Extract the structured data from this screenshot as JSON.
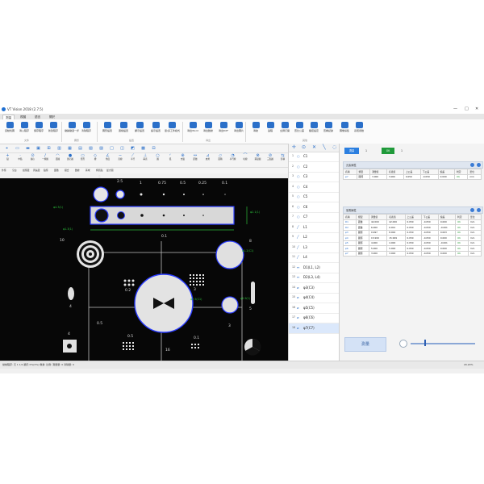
{
  "window": {
    "title": "VT Vision 2018 (2.7.5)",
    "controls": [
      "—",
      "□",
      "✕"
    ]
  },
  "menu_tabs": [
    "測量",
    "視圖",
    "語言",
    "關於"
  ],
  "ribbon": {
    "buttons": [
      {
        "label": "自動找圖",
        "color": "#2a6fc9"
      },
      {
        "label": "導入程序",
        "color": "#2a6fc9"
      },
      {
        "label": "保存程序",
        "color": "#2a6fc9"
      },
      {
        "label": "新建程序",
        "color": "#2a6fc9"
      },
      {
        "label": "撤銷撤退一步",
        "color": "#2a6fc9"
      },
      {
        "label": "清除程序",
        "color": "#2a6fc9"
      },
      {
        "label": "圖形設置",
        "color": "#2a6fc9"
      },
      {
        "label": "邊緣設置",
        "color": "#2a6fc9"
      },
      {
        "label": "顯示設置",
        "color": "#2a6fc9"
      },
      {
        "label": "提示設置",
        "color": "#2a6fc9"
      },
      {
        "label": "單/多工件模式",
        "color": "#2a6fc9"
      },
      {
        "label": "導出Word",
        "color": "#2a6fc9"
      },
      {
        "label": "導出數據",
        "color": "#2a6fc9"
      },
      {
        "label": "導出DXF",
        "color": "#2a6fc9"
      },
      {
        "label": "導出圖片",
        "color": "#2a6fc9"
      },
      {
        "label": "導航",
        "color": "#2a6fc9"
      },
      {
        "label": "遠程",
        "color": "#2a6fc9"
      },
      {
        "label": "全屏打開",
        "color": "#2a6fc9"
      },
      {
        "label": "查比公差",
        "color": "#2a6fc9"
      },
      {
        "label": "觸控設定",
        "color": "#2a6fc9"
      },
      {
        "label": "查看記錄",
        "color": "#2a6fc9"
      },
      {
        "label": "圖像採集",
        "color": "#2a6fc9"
      },
      {
        "label": "系統參數",
        "color": "#2a6fc9"
      }
    ],
    "groups": [
      "文件",
      "圖形",
      "設置",
      "導出",
      "其他"
    ]
  },
  "tools_row1": [
    "⌖",
    "▭",
    "▬",
    "▣",
    "⊞",
    "▥",
    "▦",
    "▤",
    "▧",
    "▨",
    "□",
    "◫",
    "◩",
    "▩",
    "⊟"
  ],
  "tools_row2": [
    {
      "g": "+",
      "l": "點"
    },
    {
      "g": "·",
      "l": "中點"
    },
    {
      "g": "⊙",
      "l": "圓心"
    },
    {
      "g": "∕",
      "l": "一線圓"
    },
    {
      "g": "◠",
      "l": "弧圓"
    },
    {
      "g": "●",
      "l": "實心圓"
    },
    {
      "g": "▭",
      "l": "矩形"
    },
    {
      "g": "◇",
      "l": "槽"
    },
    {
      "g": "∠",
      "l": "角度"
    },
    {
      "g": "─",
      "l": "直線"
    },
    {
      "g": "⟋",
      "l": "平行"
    },
    {
      "g": "⊥",
      "l": "垂直"
    },
    {
      "g": "○",
      "l": "圓"
    },
    {
      "g": "◜",
      "l": "弧"
    },
    {
      "g": "⊕",
      "l": "交點"
    },
    {
      "g": "↔",
      "l": "距離"
    },
    {
      "g": "⊿",
      "l": "夾角"
    },
    {
      "g": "▱",
      "l": "面積"
    },
    {
      "g": "◔",
      "l": "平行線"
    },
    {
      "g": "⌒",
      "l": "切線"
    },
    {
      "g": "⊗",
      "l": "兩點圓"
    },
    {
      "g": "⊘",
      "l": "三點圓"
    },
    {
      "g": "⇆",
      "l": "對稱"
    },
    {
      "g": "⇳",
      "l": "構造"
    },
    {
      "g": "◪",
      "l": "1查看"
    },
    {
      "g": "◰",
      "l": "1刪除"
    }
  ],
  "tools_row3": [
    "外徑",
    "空白",
    "如徑距",
    "周長距",
    "點徑",
    "面積",
    "擬合",
    "數據",
    "區域",
    "極值點",
    "最大圓"
  ],
  "canvas": {
    "labels_top": [
      "5",
      "2.5",
      "1",
      "0.75",
      "0.5",
      "0.25",
      "0.1"
    ],
    "labels_mid": [
      "10",
      "0.1",
      "0.2",
      "8",
      "3",
      "4",
      "4",
      "0.5",
      "0.5",
      "16",
      "0.1",
      "3",
      "5"
    ],
    "measurements": [
      "φ4.3(1)",
      "φ1.3(1)",
      "φ2.1(1)",
      "φ0.9(1)",
      "φ7.5(C1)",
      "φ1.2(C1)"
    ]
  },
  "entities": [
    {
      "n": "1",
      "icon": "○",
      "name": "C1"
    },
    {
      "n": "2",
      "icon": "○",
      "name": "C2"
    },
    {
      "n": "3",
      "icon": "○",
      "name": "C3"
    },
    {
      "n": "4",
      "icon": "○",
      "name": "C4"
    },
    {
      "n": "5",
      "icon": "○",
      "name": "C5"
    },
    {
      "n": "6",
      "icon": "○",
      "name": "C6"
    },
    {
      "n": "7",
      "icon": "○",
      "name": "C7"
    },
    {
      "n": "8",
      "icon": "╱",
      "name": "L1"
    },
    {
      "n": "9",
      "icon": "╱",
      "name": "L2"
    },
    {
      "n": "10",
      "icon": "╱",
      "name": "L3"
    },
    {
      "n": "11",
      "icon": "╱",
      "name": "L4"
    },
    {
      "n": "12",
      "icon": "↔",
      "name": "D1(L1, L2)"
    },
    {
      "n": "13",
      "icon": "↔",
      "name": "D2(L3, L4)"
    },
    {
      "n": "14",
      "icon": "⌀",
      "name": "φ3(C3)"
    },
    {
      "n": "15",
      "icon": "⌀",
      "name": "φ4(C4)"
    },
    {
      "n": "16",
      "icon": "⌀",
      "name": "φ5(C5)"
    },
    {
      "n": "17",
      "icon": "⌀",
      "name": "φ6(C6)"
    },
    {
      "n": "18",
      "icon": "⌀",
      "name": "φ7(C7)"
    }
  ],
  "panel": {
    "buttons": [
      {
        "label": "測量",
        "color": "#2b7fe0"
      },
      {
        "label": "1",
        "color": "#f3f3f3"
      },
      {
        "label": "OK",
        "color": "#1f9a3a"
      },
      {
        "label": "1",
        "color": "#f3f3f3"
      }
    ],
    "section1": "元素屬性",
    "section2": "量測屬性",
    "table_headers": [
      "名稱",
      "類型",
      "測量值",
      "名義值",
      "上公差",
      "下公差",
      "偏差",
      "判定",
      "單位"
    ],
    "table1": [
      [
        "φ7",
        "圓徑",
        "",
        "",
        "",
        "",
        "",
        "",
        ""
      ]
    ],
    "table1_values": [
      [
        "φ7",
        "圓徑",
        "3.000",
        "3.000",
        "0.050",
        "-0.050",
        "0.000",
        "OK",
        "mm"
      ]
    ],
    "table2": [
      [
        "D1",
        "距離",
        "42.000",
        "42.000",
        "0.050",
        "-0.050",
        "0.000",
        "OK",
        "mm"
      ],
      [
        "D2",
        "距離",
        "6.000",
        "6.001",
        "0.050",
        "-0.050",
        "-0.001",
        "OK",
        "mm"
      ],
      [
        "φ3",
        "圓徑",
        "0.997",
        "8.000",
        "0.050",
        "-0.050",
        "0.003",
        "OK",
        "mm"
      ],
      [
        "φ4",
        "圓徑",
        "15.999",
        "15.999",
        "0.050",
        "-0.050",
        "0.000",
        "OK",
        "mm"
      ],
      [
        "φ5",
        "圓徑",
        "4.000",
        "4.000",
        "0.050",
        "-0.050",
        "-0.001",
        "OK",
        "mm"
      ],
      [
        "φ6",
        "圓徑",
        "5.000",
        "5.000",
        "0.050",
        "-0.050",
        "0.000",
        "OK",
        "mm"
      ],
      [
        "φ7",
        "圓徑",
        "3.000",
        "3.000",
        "0.050",
        "-0.050",
        "0.000",
        "OK",
        "mm"
      ]
    ],
    "big_button": "測量"
  },
  "status": {
    "left": "當前程序: 元 1 1/1 顯示 0%(0%) 像素: 比例: 測量量: 0 清除量: 0",
    "right": "20.20%"
  }
}
